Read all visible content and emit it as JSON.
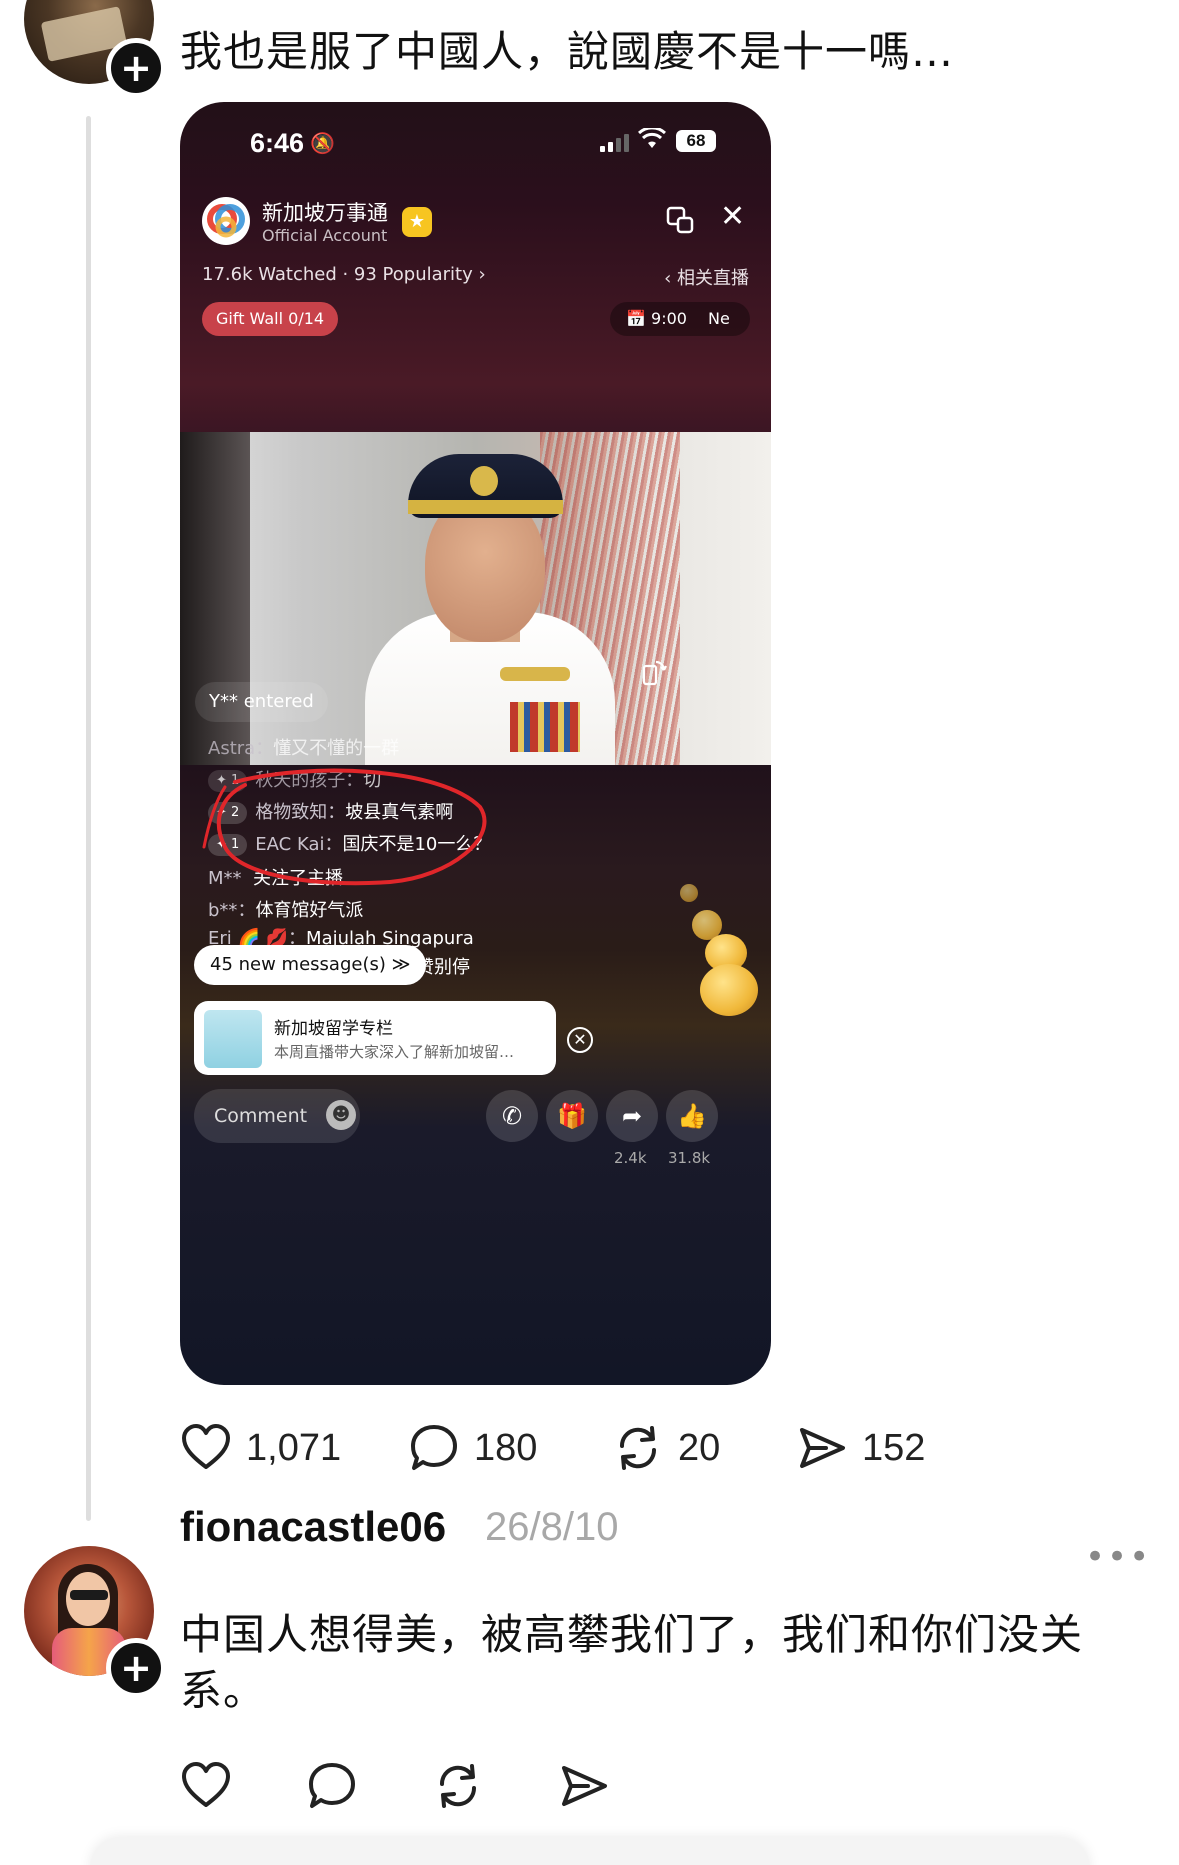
{
  "post1": {
    "text": "我也是服了中國人，說國慶不是十一嗎…",
    "actions": {
      "likes": "1,071",
      "replies": "180",
      "reposts": "20",
      "shares": "152"
    }
  },
  "screenshot": {
    "status": {
      "time": "6:46",
      "battery": "68"
    },
    "account": {
      "name": "新加坡万事通",
      "subtitle": "Official Account"
    },
    "stats": "17.6k Watched · 93 Popularity ›",
    "related": "‹ 相关直播",
    "gift_wall": "Gift Wall 0/14",
    "schedule": {
      "time": "9:00",
      "next": "Ne"
    },
    "entered": "Y** entered",
    "messages": [
      {
        "level": "",
        "user": "Astra",
        "text": "懂又不懂的一群"
      },
      {
        "level": "✦ 1",
        "user": "秋天的孩子",
        "text": "切"
      },
      {
        "level": "✦ 2",
        "user": "格物致知",
        "text": "坡县真气素啊"
      },
      {
        "level": "✦ 1",
        "user": "EAC Kai",
        "text": "国庆不是10一么？"
      },
      {
        "level": "",
        "user": "M**",
        "text": "关注了主播"
      },
      {
        "level": "",
        "user": "b**",
        "text": "体育馆好气派"
      },
      {
        "level": "",
        "user": "Eri 🌈 💋",
        "text": "Majulah Singapura"
      }
    ],
    "new_messages": "45 new message(s) ≫",
    "new_messages_tail": "家点赞别停",
    "promo": {
      "title": "新加坡留学专栏",
      "desc": "本周直播带大家深入了解新加坡留…"
    },
    "comment_placeholder": "Comment",
    "share_count": "2.4k",
    "like_count": "31.8k"
  },
  "post2": {
    "username": "fionacastle06",
    "date": "26/8/10",
    "more": "•••",
    "text": "中国人想得美，被高攀我们了，我们和你们没关系。"
  },
  "colors": {
    "annotation_red": "#e0262a",
    "gift_wall_red": "#c8424a"
  }
}
